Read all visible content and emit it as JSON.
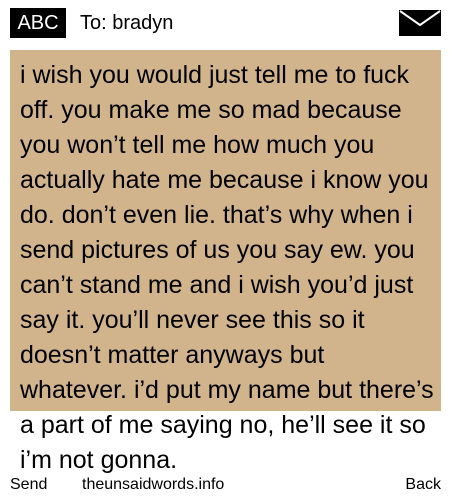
{
  "header": {
    "input_mode": "ABC",
    "to_label": "To:",
    "recipient": "bradyn",
    "envelope_icon": "envelope-icon"
  },
  "message": {
    "body": "i wish you would just tell me to fuck off. you make me so mad because you won’t tell me how much you actually hate me because i know you do. don’t even lie. that’s why when i send pictures of us you say ew. you can’t stand me and i wish you’d just say it. you’ll never see this so it doesn’t matter anyways but whatever. i’d put my name but there’s a part of me saying no, he’ll see it so i’m not gonna."
  },
  "footer": {
    "send_label": "Send",
    "watermark": "theunsaidwords.info",
    "back_label": "Back"
  },
  "colors": {
    "message_background": "#d2b48c",
    "badge_background": "#000000",
    "text": "#000000"
  }
}
